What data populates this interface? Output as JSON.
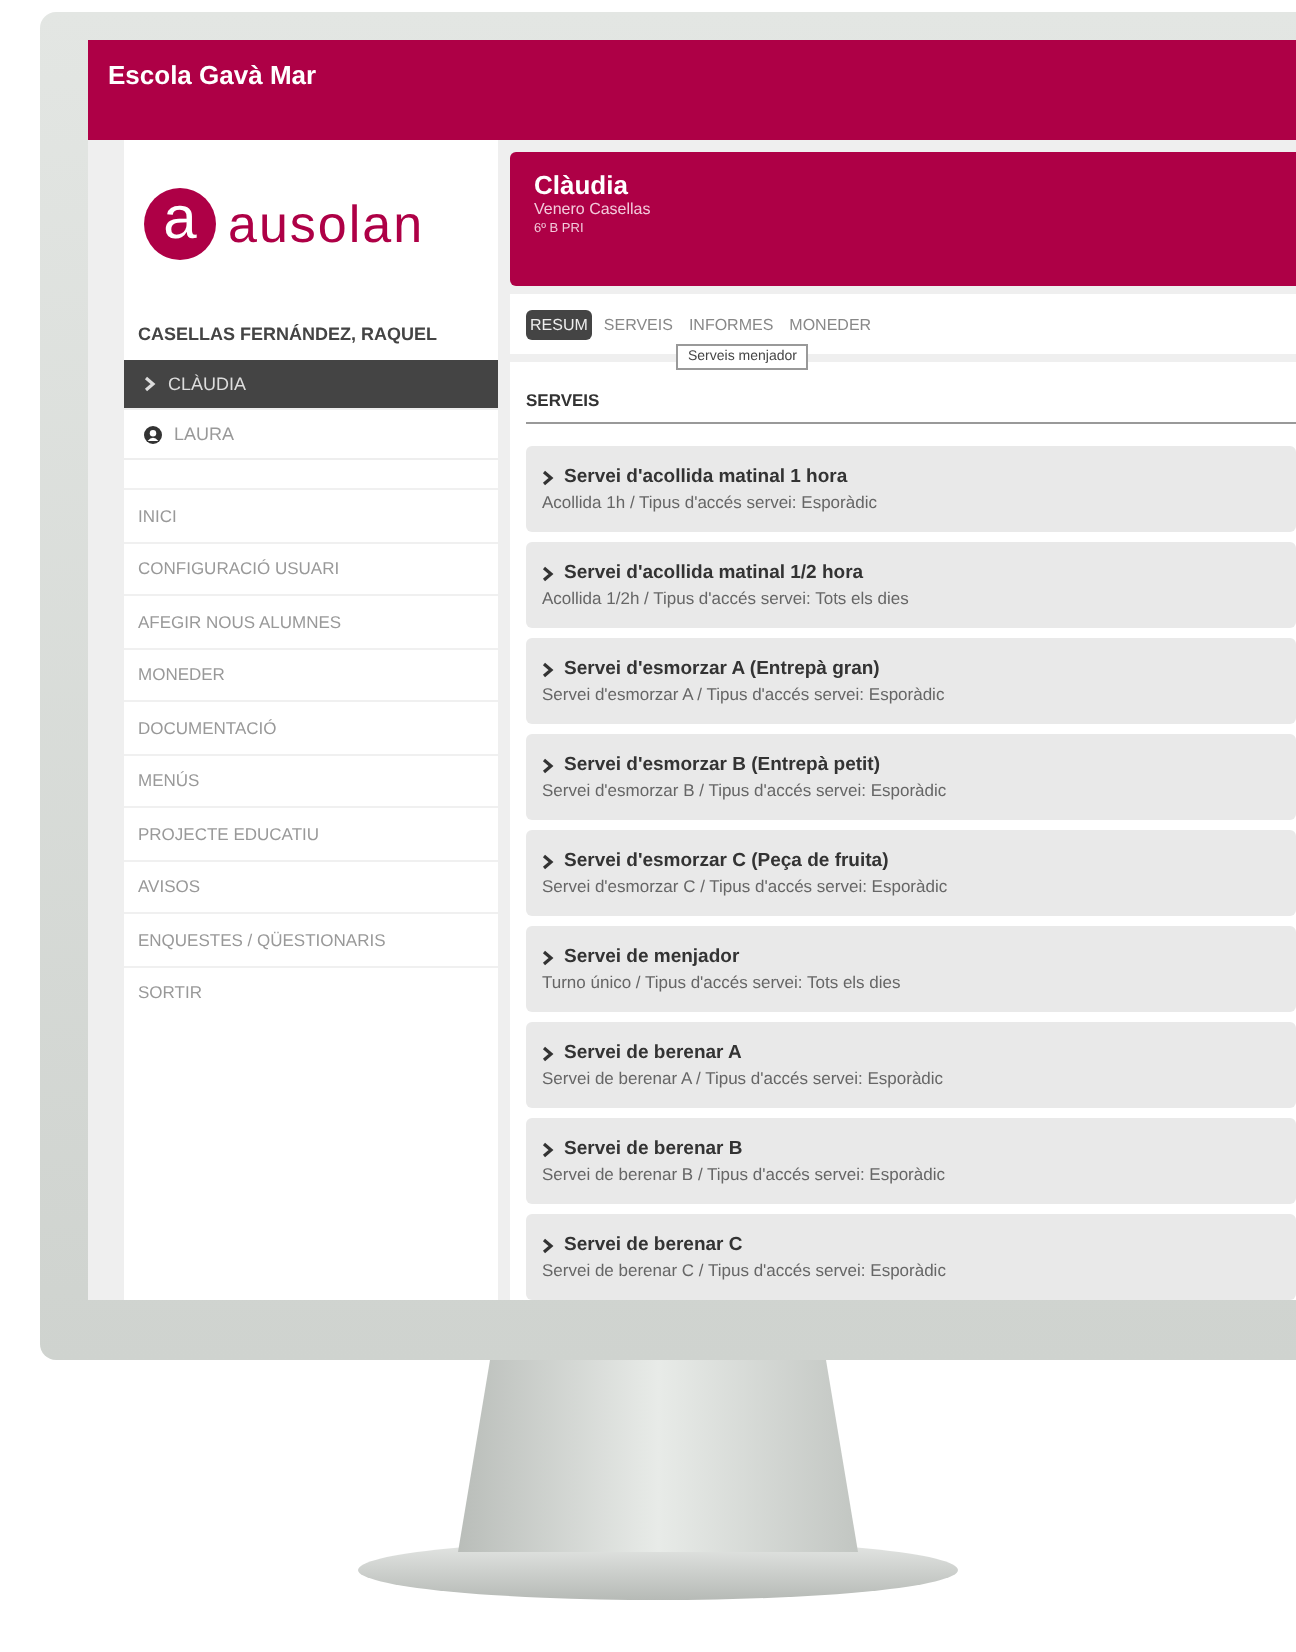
{
  "header": {
    "title": "Escola Gavà Mar"
  },
  "logo": {
    "mark": "a",
    "text": "ausolan"
  },
  "sidebar": {
    "parent": "CASELLAS FERNÁNDEZ, RAQUEL",
    "children": [
      {
        "name": "CLÀUDIA",
        "selected": true
      },
      {
        "name": "LAURA",
        "selected": false
      }
    ],
    "menu": [
      "INICI",
      "CONFIGURACIÓ USUARI",
      "AFEGIR NOUS ALUMNES",
      "MONEDER",
      "DOCUMENTACIÓ",
      "MENÚS",
      "PROJECTE EDUCATIU",
      "AVISOS",
      "ENQUESTES / QÜESTIONARIS",
      "SORTIR"
    ]
  },
  "student": {
    "name": "Clàudia",
    "surname": "Venero Casellas",
    "class": "6º B PRI"
  },
  "tabs": [
    {
      "label": "RESUM",
      "selected": true
    },
    {
      "label": "SERVEIS",
      "selected": false
    },
    {
      "label": "INFORMES",
      "selected": false
    },
    {
      "label": "MONEDER",
      "selected": false
    }
  ],
  "tooltip": "Serveis menjador",
  "section_title": "SERVEIS",
  "services": [
    {
      "title": "Servei d'acollida matinal 1 hora",
      "detail": "Acollida 1h / Tipus d'accés servei: Esporàdic"
    },
    {
      "title": "Servei d'acollida matinal 1/2 hora",
      "detail": "Acollida 1/2h / Tipus d'accés servei: Tots els dies"
    },
    {
      "title": "Servei d'esmorzar A (Entrepà gran)",
      "detail": "Servei d'esmorzar A / Tipus d'accés servei: Esporàdic"
    },
    {
      "title": "Servei d'esmorzar B (Entrepà petit)",
      "detail": "Servei d'esmorzar B / Tipus d'accés servei: Esporàdic"
    },
    {
      "title": "Servei d'esmorzar C (Peça de fruita)",
      "detail": "Servei d'esmorzar C / Tipus d'accés servei: Esporàdic"
    },
    {
      "title": "Servei de menjador",
      "detail": "Turno único / Tipus d'accés servei: Tots els dies"
    },
    {
      "title": "Servei de berenar A",
      "detail": "Servei de berenar A / Tipus d'accés servei: Esporàdic"
    },
    {
      "title": "Servei de berenar B",
      "detail": "Servei de berenar B / Tipus d'accés servei: Esporàdic"
    },
    {
      "title": "Servei de berenar C",
      "detail": "Servei de berenar C / Tipus d'accés servei: Esporàdic"
    }
  ]
}
